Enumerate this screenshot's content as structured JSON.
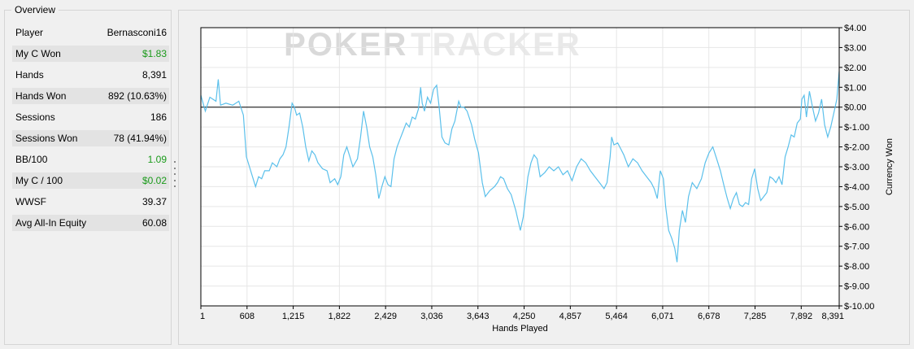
{
  "overview": {
    "title": "Overview",
    "rows": [
      {
        "label": "Player",
        "value": "Bernasconi16",
        "shaded": false,
        "green": false
      },
      {
        "label": "My C Won",
        "value": "$1.83",
        "shaded": true,
        "green": true
      },
      {
        "label": "Hands",
        "value": "8,391",
        "shaded": false,
        "green": false
      },
      {
        "label": "Hands Won",
        "value": "892 (10.63%)",
        "shaded": true,
        "green": false
      },
      {
        "label": "Sessions",
        "value": "186",
        "shaded": false,
        "green": false
      },
      {
        "label": "Sessions Won",
        "value": "78 (41.94%)",
        "shaded": true,
        "green": false
      },
      {
        "label": "BB/100",
        "value": "1.09",
        "shaded": false,
        "green": true
      },
      {
        "label": "My C / 100",
        "value": "$0.02",
        "shaded": true,
        "green": true
      },
      {
        "label": "WWSF",
        "value": "39.37",
        "shaded": false,
        "green": false
      },
      {
        "label": "Avg All-In Equity",
        "value": "60.08",
        "shaded": true,
        "green": false
      }
    ]
  },
  "watermark": {
    "left": "POKER",
    "right": "TRACKER"
  },
  "colors": {
    "line": "#5bc0eb",
    "zero_line": "#000000",
    "positive": "#1a9a1a",
    "grid": "#e6e6e6"
  },
  "chart_data": {
    "type": "line",
    "xlabel": "Hands Played",
    "ylabel": "Currency Won",
    "xlim": [
      1,
      8391
    ],
    "ylim": [
      -10,
      4
    ],
    "x_ticks": [
      "1",
      "608",
      "1,215",
      "1,822",
      "2,429",
      "3,036",
      "3,643",
      "4,250",
      "4,857",
      "5,464",
      "6,071",
      "6,678",
      "7,285",
      "7,892",
      "8,391"
    ],
    "y_ticks": [
      "$4.00",
      "$3.00",
      "$2.00",
      "$1.00",
      "$0.00",
      "$-1.00",
      "$-2.00",
      "$-3.00",
      "$-4.00",
      "$-5.00",
      "$-6.00",
      "$-7.00",
      "$-8.00",
      "$-9.00",
      "$-10.00"
    ],
    "grid": true,
    "series": [
      {
        "values": [
          [
            1,
            0.6
          ],
          [
            60,
            -0.2
          ],
          [
            120,
            0.5
          ],
          [
            200,
            0.3
          ],
          [
            230,
            1.4
          ],
          [
            260,
            0.1
          ],
          [
            330,
            0.2
          ],
          [
            420,
            0.1
          ],
          [
            500,
            0.3
          ],
          [
            560,
            -0.4
          ],
          [
            600,
            -2.5
          ],
          [
            640,
            -3.0
          ],
          [
            680,
            -3.5
          ],
          [
            720,
            -4.0
          ],
          [
            760,
            -3.5
          ],
          [
            800,
            -3.6
          ],
          [
            840,
            -3.2
          ],
          [
            900,
            -3.2
          ],
          [
            940,
            -2.8
          ],
          [
            1000,
            -3.0
          ],
          [
            1040,
            -2.6
          ],
          [
            1080,
            -2.4
          ],
          [
            1120,
            -2.0
          ],
          [
            1160,
            -1.0
          ],
          [
            1200,
            0.2
          ],
          [
            1230,
            0.0
          ],
          [
            1260,
            -0.4
          ],
          [
            1300,
            -0.3
          ],
          [
            1340,
            -1.0
          ],
          [
            1380,
            -2.0
          ],
          [
            1420,
            -2.7
          ],
          [
            1460,
            -2.2
          ],
          [
            1500,
            -2.4
          ],
          [
            1540,
            -2.8
          ],
          [
            1600,
            -3.1
          ],
          [
            1660,
            -3.2
          ],
          [
            1700,
            -3.8
          ],
          [
            1760,
            -3.6
          ],
          [
            1800,
            -3.9
          ],
          [
            1840,
            -3.5
          ],
          [
            1880,
            -2.4
          ],
          [
            1920,
            -2.0
          ],
          [
            1960,
            -2.5
          ],
          [
            2000,
            -3.0
          ],
          [
            2060,
            -2.6
          ],
          [
            2100,
            -1.5
          ],
          [
            2140,
            -0.2
          ],
          [
            2180,
            -1.0
          ],
          [
            2220,
            -2.0
          ],
          [
            2260,
            -2.5
          ],
          [
            2300,
            -3.4
          ],
          [
            2340,
            -4.6
          ],
          [
            2380,
            -4.0
          ],
          [
            2420,
            -3.5
          ],
          [
            2460,
            -3.9
          ],
          [
            2500,
            -4.0
          ],
          [
            2540,
            -2.6
          ],
          [
            2580,
            -2.0
          ],
          [
            2620,
            -1.6
          ],
          [
            2660,
            -1.2
          ],
          [
            2700,
            -0.8
          ],
          [
            2740,
            -1.0
          ],
          [
            2780,
            -0.5
          ],
          [
            2820,
            -0.6
          ],
          [
            2860,
            -0.1
          ],
          [
            2890,
            1.0
          ],
          [
            2910,
            0.2
          ],
          [
            2940,
            -0.2
          ],
          [
            2980,
            0.5
          ],
          [
            3020,
            0.2
          ],
          [
            3060,
            0.9
          ],
          [
            3100,
            1.1
          ],
          [
            3130,
            0.1
          ],
          [
            3170,
            -1.5
          ],
          [
            3210,
            -1.8
          ],
          [
            3260,
            -1.9
          ],
          [
            3300,
            -1.1
          ],
          [
            3340,
            -0.7
          ],
          [
            3390,
            0.3
          ],
          [
            3420,
            0.0
          ],
          [
            3460,
            0.0
          ],
          [
            3500,
            -0.2
          ],
          [
            3560,
            -0.9
          ],
          [
            3600,
            -1.6
          ],
          [
            3650,
            -2.3
          ],
          [
            3700,
            -3.8
          ],
          [
            3740,
            -4.5
          ],
          [
            3800,
            -4.2
          ],
          [
            3860,
            -4.0
          ],
          [
            3900,
            -3.8
          ],
          [
            3940,
            -3.5
          ],
          [
            3980,
            -3.6
          ],
          [
            4030,
            -4.1
          ],
          [
            4080,
            -4.4
          ],
          [
            4140,
            -5.2
          ],
          [
            4200,
            -6.2
          ],
          [
            4240,
            -5.5
          ],
          [
            4270,
            -4.5
          ],
          [
            4300,
            -3.5
          ],
          [
            4340,
            -2.8
          ],
          [
            4380,
            -2.4
          ],
          [
            4420,
            -2.6
          ],
          [
            4460,
            -3.5
          ],
          [
            4520,
            -3.3
          ],
          [
            4580,
            -3.0
          ],
          [
            4640,
            -3.2
          ],
          [
            4700,
            -3.0
          ],
          [
            4760,
            -3.4
          ],
          [
            4820,
            -3.2
          ],
          [
            4880,
            -3.7
          ],
          [
            4940,
            -3.0
          ],
          [
            5000,
            -2.6
          ],
          [
            5060,
            -2.8
          ],
          [
            5120,
            -3.2
          ],
          [
            5180,
            -3.5
          ],
          [
            5240,
            -3.8
          ],
          [
            5300,
            -4.1
          ],
          [
            5340,
            -3.8
          ],
          [
            5380,
            -2.5
          ],
          [
            5400,
            -1.5
          ],
          [
            5430,
            -1.9
          ],
          [
            5480,
            -1.8
          ],
          [
            5520,
            -2.1
          ],
          [
            5560,
            -2.4
          ],
          [
            5620,
            -3.0
          ],
          [
            5680,
            -2.6
          ],
          [
            5740,
            -2.8
          ],
          [
            5800,
            -3.2
          ],
          [
            5860,
            -3.5
          ],
          [
            5920,
            -3.8
          ],
          [
            5960,
            -4.1
          ],
          [
            6000,
            -4.6
          ],
          [
            6040,
            -3.2
          ],
          [
            6080,
            -3.6
          ],
          [
            6110,
            -5.0
          ],
          [
            6150,
            -6.2
          ],
          [
            6190,
            -6.6
          ],
          [
            6230,
            -7.1
          ],
          [
            6260,
            -7.8
          ],
          [
            6290,
            -6.2
          ],
          [
            6330,
            -5.2
          ],
          [
            6370,
            -5.8
          ],
          [
            6410,
            -4.5
          ],
          [
            6460,
            -3.8
          ],
          [
            6520,
            -4.1
          ],
          [
            6580,
            -3.6
          ],
          [
            6630,
            -2.8
          ],
          [
            6680,
            -2.3
          ],
          [
            6730,
            -2.0
          ],
          [
            6780,
            -2.6
          ],
          [
            6830,
            -3.2
          ],
          [
            6880,
            -4.0
          ],
          [
            6920,
            -4.6
          ],
          [
            6960,
            -5.1
          ],
          [
            7000,
            -4.6
          ],
          [
            7040,
            -4.3
          ],
          [
            7080,
            -4.9
          ],
          [
            7120,
            -5.0
          ],
          [
            7160,
            -4.8
          ],
          [
            7200,
            -4.9
          ],
          [
            7240,
            -3.6
          ],
          [
            7280,
            -3.1
          ],
          [
            7320,
            -4.1
          ],
          [
            7360,
            -4.7
          ],
          [
            7400,
            -4.5
          ],
          [
            7440,
            -4.3
          ],
          [
            7480,
            -3.5
          ],
          [
            7520,
            -3.6
          ],
          [
            7560,
            -3.8
          ],
          [
            7600,
            -3.5
          ],
          [
            7640,
            -3.9
          ],
          [
            7680,
            -2.5
          ],
          [
            7720,
            -2.0
          ],
          [
            7760,
            -1.4
          ],
          [
            7800,
            -1.5
          ],
          [
            7840,
            -0.8
          ],
          [
            7880,
            -0.6
          ],
          [
            7900,
            0.4
          ],
          [
            7930,
            0.6
          ],
          [
            7960,
            -0.5
          ],
          [
            8000,
            0.8
          ],
          [
            8040,
            0.0
          ],
          [
            8080,
            -0.7
          ],
          [
            8120,
            -0.3
          ],
          [
            8160,
            0.4
          ],
          [
            8200,
            -0.9
          ],
          [
            8240,
            -1.5
          ],
          [
            8280,
            -1.0
          ],
          [
            8320,
            -0.3
          ],
          [
            8360,
            0.4
          ],
          [
            8391,
            1.8
          ]
        ]
      }
    ]
  }
}
